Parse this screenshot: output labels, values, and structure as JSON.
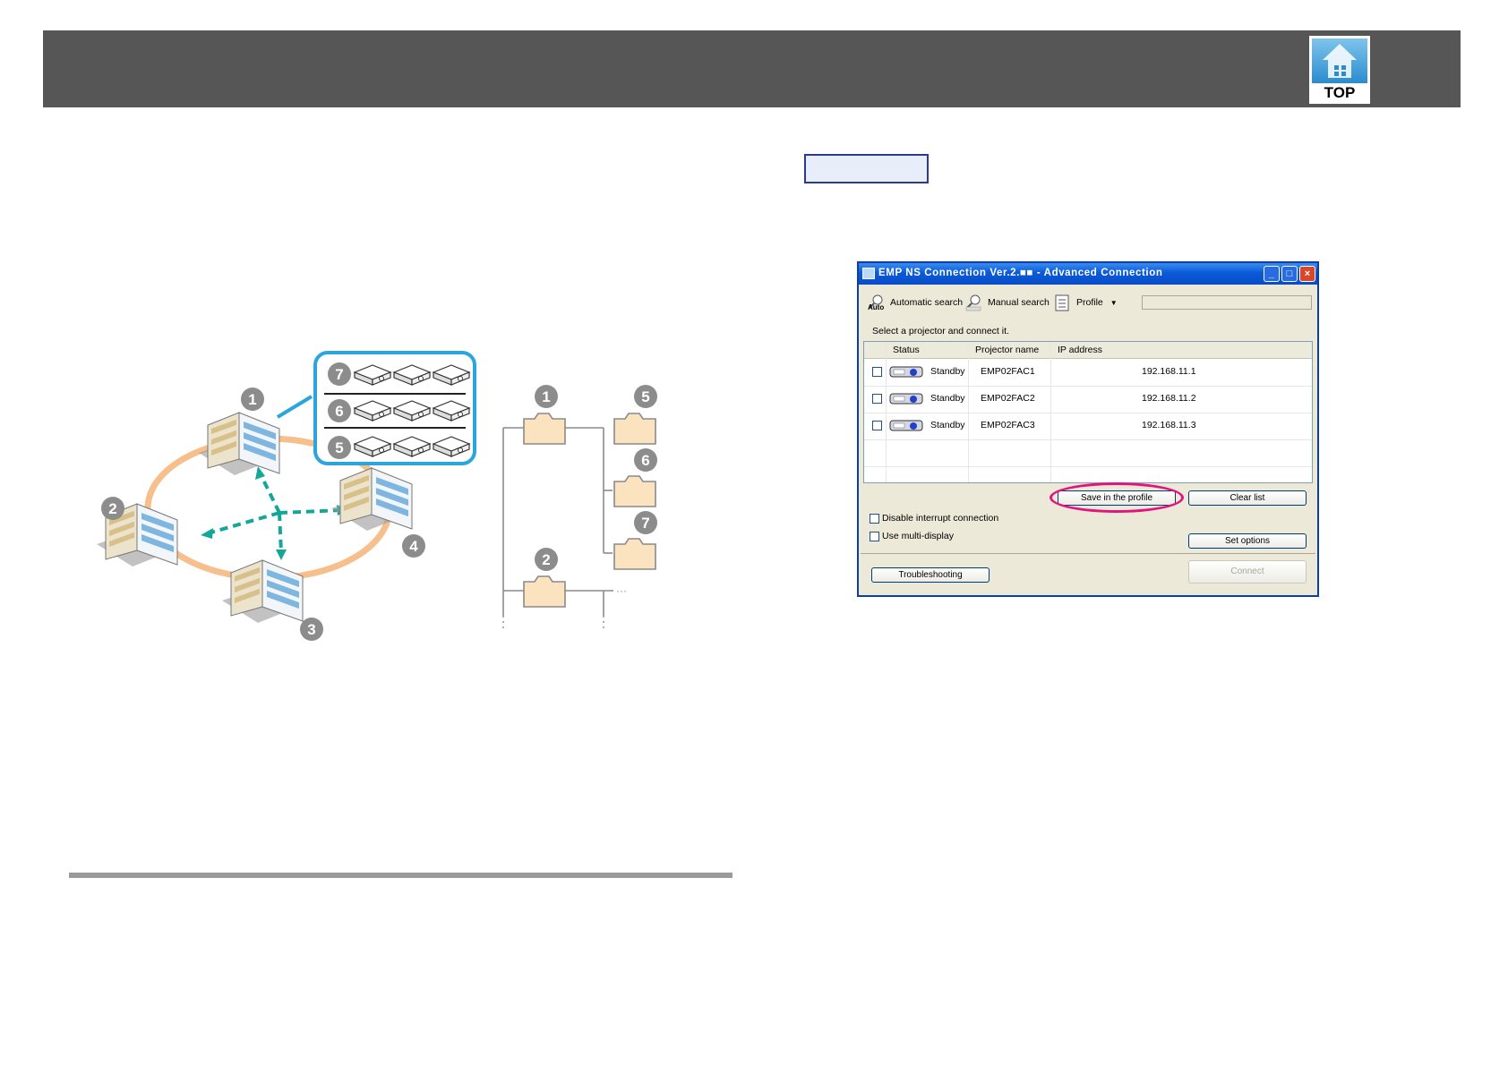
{
  "header": {
    "logo_text": "TOP"
  },
  "diagram_left": {
    "labels": [
      "1",
      "2",
      "3",
      "4",
      "5",
      "6",
      "7"
    ],
    "colors": {
      "ring": "#f6bf8c",
      "arrow": "#13a79a",
      "callout": "#2aa6dc"
    }
  },
  "diagram_tree": {
    "labels": [
      "1",
      "5",
      "6",
      "7",
      "2"
    ],
    "ellipsis": "···",
    "colors": {
      "folder_fill": "#fbe3c0",
      "folder_stroke": "#8a8a8a"
    }
  },
  "dialog": {
    "title": "EMP NS Connection Ver.2.■■ - Advanced Connection",
    "toolbar": {
      "automatic_search": "Automatic search",
      "auto_icon_text": "Auto",
      "manual_search": "Manual search",
      "profile": "Profile"
    },
    "hint": "Select a projector and connect it.",
    "columns": {
      "status": "Status",
      "name": "Projector name",
      "ip": "IP address"
    },
    "rows": [
      {
        "status": "Standby",
        "name": "EMP02FAC1",
        "ip": "192.168.11.1"
      },
      {
        "status": "Standby",
        "name": "EMP02FAC2",
        "ip": "192.168.11.2"
      },
      {
        "status": "Standby",
        "name": "EMP02FAC3",
        "ip": "192.168.11.3"
      }
    ],
    "buttons": {
      "save_profile": "Save in the profile",
      "clear_list": "Clear list",
      "set_options": "Set options",
      "troubleshooting": "Troubleshooting",
      "connect": "Connect"
    },
    "checks": {
      "disable_interrupt": "Disable interrupt connection",
      "multi_display": "Use multi-display"
    },
    "highlight_color": "#e0157f"
  }
}
